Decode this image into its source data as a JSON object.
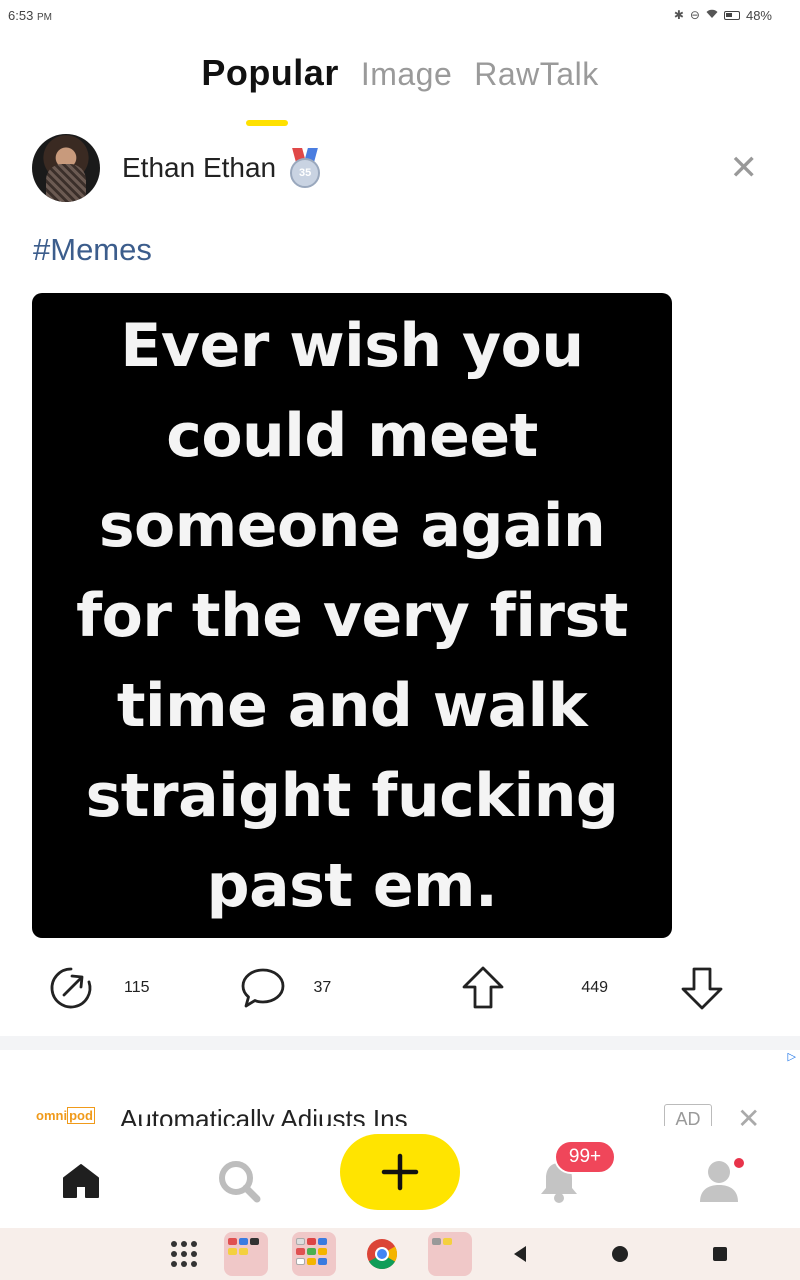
{
  "status_bar": {
    "time": "6:53",
    "ampm": "PM",
    "battery": "48%",
    "icons": [
      "bluetooth-icon",
      "dnd-icon",
      "wifi-icon",
      "battery-icon"
    ]
  },
  "tabs": [
    {
      "label": "Popular",
      "active": true
    },
    {
      "label": "Image",
      "active": false
    },
    {
      "label": "RawTalk",
      "active": false
    }
  ],
  "post": {
    "username": "Ethan Ethan",
    "medal_level": "35",
    "hashtag": "#Memes",
    "meme_lines": [
      "Ever wish you",
      "could meet",
      "someone again",
      "for the very first",
      "time and walk",
      "straight fucking",
      "past em."
    ],
    "share_count": "115",
    "comment_count": "37",
    "vote_count": "449"
  },
  "ad": {
    "brand": "omnipod",
    "brand_part1": "omni",
    "brand_part2": "pod",
    "headline": "Automatically Adjusts Ins",
    "badge": "AD",
    "marker": "▷"
  },
  "bottom_nav": {
    "notification_badge": "99+",
    "accent": "#ffe400",
    "badge_color": "#f0465a"
  }
}
